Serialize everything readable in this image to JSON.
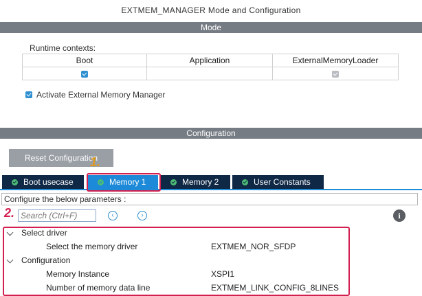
{
  "window_title": "EXTMEM_MANAGER Mode and Configuration",
  "mode_bar": "Mode",
  "runtime": {
    "label": "Runtime contexts:",
    "columns": [
      "Boot",
      "Application",
      "ExternalMemoryLoader"
    ],
    "boot_checked": true,
    "application_checked": false,
    "loader_checked": true
  },
  "activate_label": "Activate External Memory Manager",
  "config_bar": "Configuration",
  "reset_button": "Reset Configuration",
  "tabs": [
    "Boot usecase",
    "Memory 1",
    "Memory 2",
    "User Constants"
  ],
  "active_tab": "Memory 1",
  "params_hint": "Configure the below parameters :",
  "search_placeholder": "Search (Ctrl+F)",
  "annotations": [
    "1.",
    "2."
  ],
  "sections": [
    {
      "title": "Select driver",
      "params": [
        {
          "name": "Select the memory driver",
          "value": "EXTMEM_NOR_SFDP"
        }
      ]
    },
    {
      "title": "Configuration",
      "params": [
        {
          "name": "Memory Instance",
          "value": "XSPI1"
        },
        {
          "name": "Number of memory data line",
          "value": "EXTMEM_LINK_CONFIG_8LINES"
        }
      ]
    }
  ],
  "colors": {
    "bar": "#767c84",
    "tab": "#0f2846",
    "tab_active": "#1c8ad8",
    "highlight": "#d21f4f",
    "annotation_1": "#e29a1c"
  }
}
